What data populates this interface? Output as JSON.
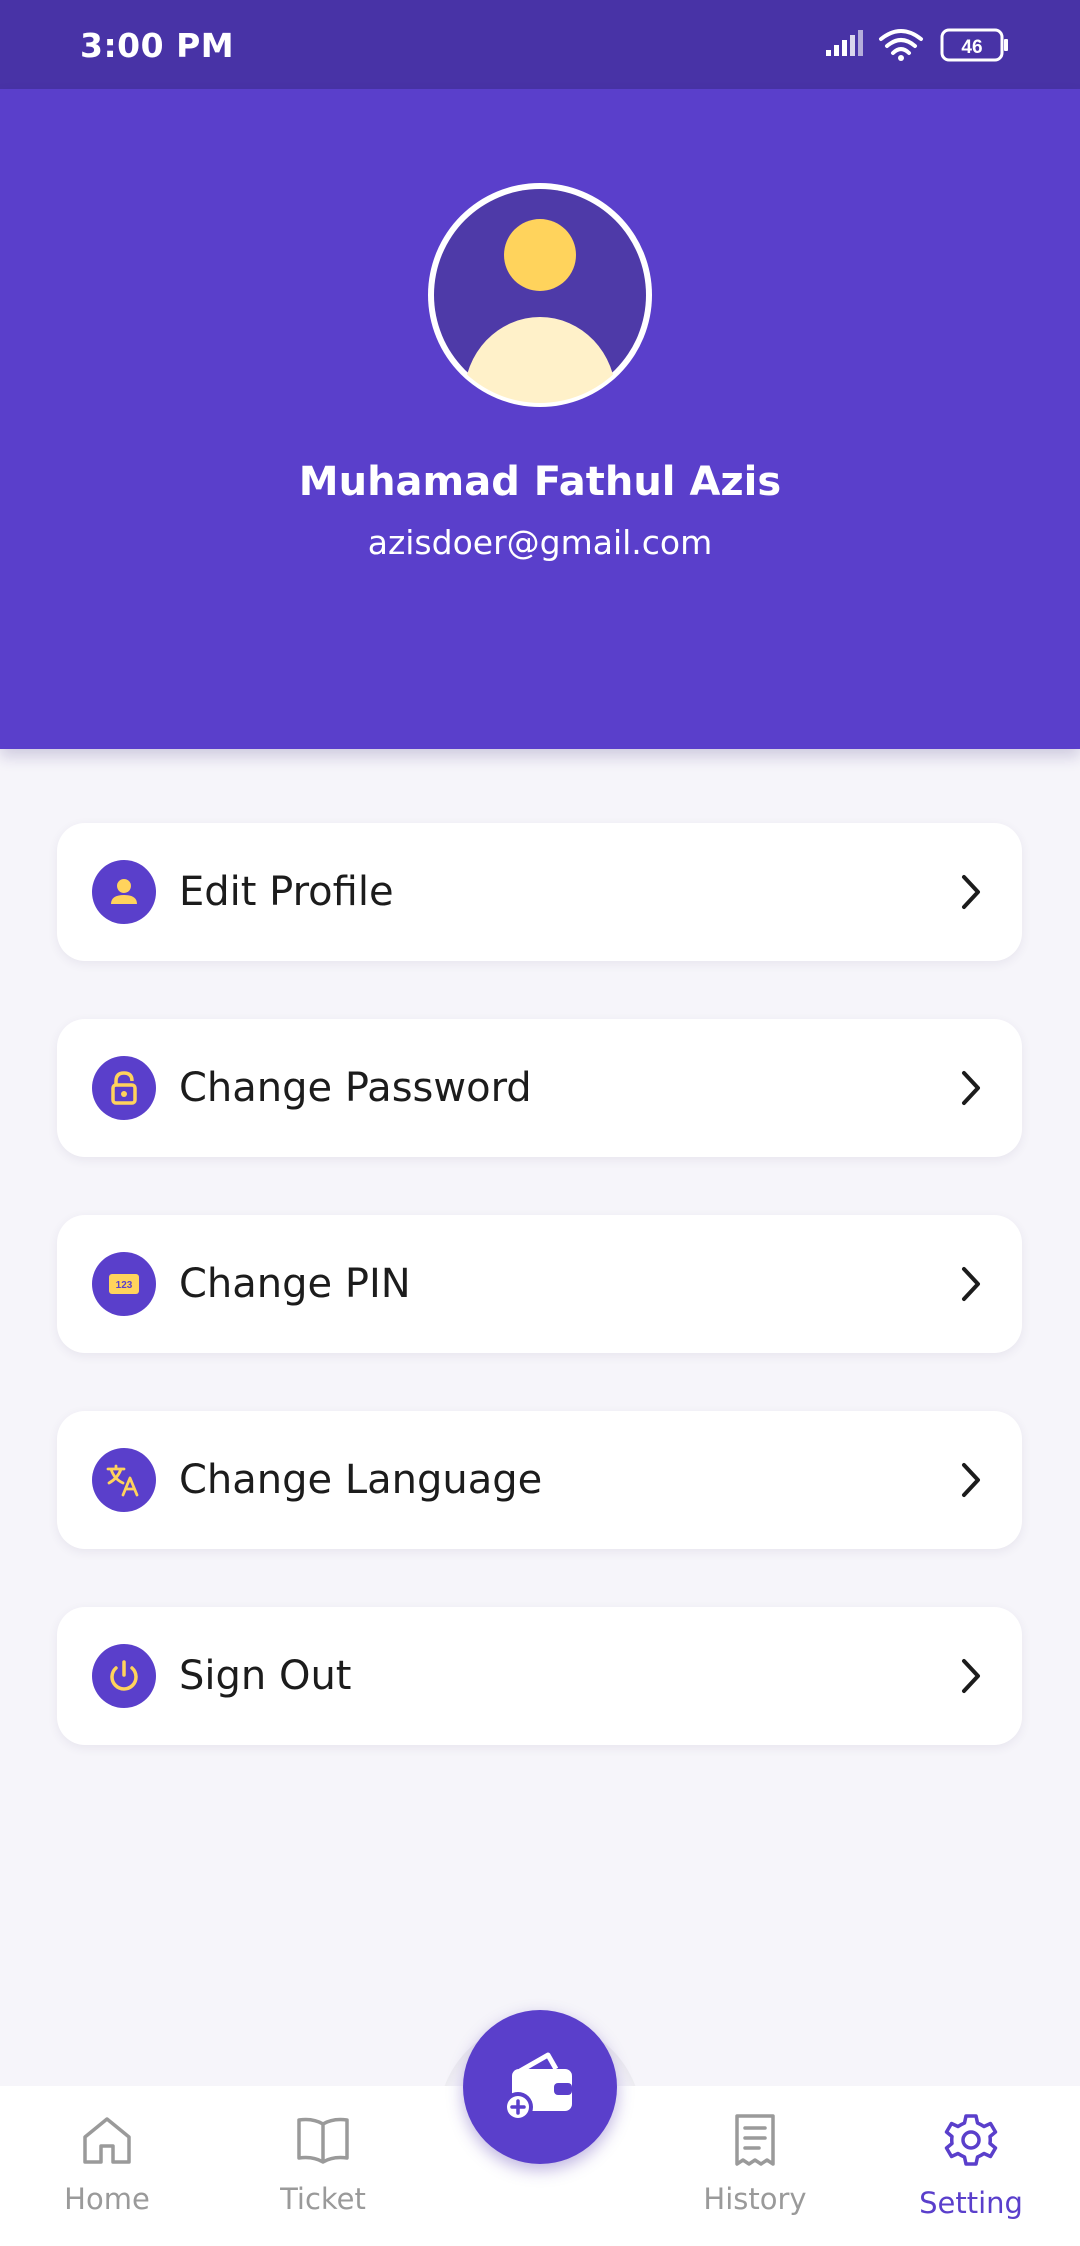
{
  "status_bar": {
    "time": "3:00 PM",
    "battery": "46",
    "icons": [
      "signal-icon",
      "wifi-icon",
      "battery-icon"
    ]
  },
  "profile": {
    "name": "Muhamad Fathul Azis",
    "email": "azisdoer@gmail.com"
  },
  "menu": {
    "items": [
      {
        "label": "Edit Profile",
        "icon": "person-icon"
      },
      {
        "label": "Change Password",
        "icon": "lock-icon"
      },
      {
        "label": "Change PIN",
        "icon": "pin-icon",
        "icon_text": "123"
      },
      {
        "label": "Change Language",
        "icon": "translate-icon"
      },
      {
        "label": "Sign Out",
        "icon": "power-icon"
      }
    ]
  },
  "bottom_nav": {
    "items": [
      {
        "label": "Home",
        "icon": "home-icon",
        "active": false
      },
      {
        "label": "Ticket",
        "icon": "book-icon",
        "active": false
      },
      {
        "label": "History",
        "icon": "receipt-icon",
        "active": false
      },
      {
        "label": "Setting",
        "icon": "gear-icon",
        "active": true
      }
    ],
    "fab_icon": "wallet-add-icon"
  },
  "colors": {
    "primary": "#5a3fcb",
    "status_bar": "#4833a6",
    "accent": "#ffd35c",
    "background": "#f6f5fa",
    "inactive": "#9a9a9a"
  }
}
